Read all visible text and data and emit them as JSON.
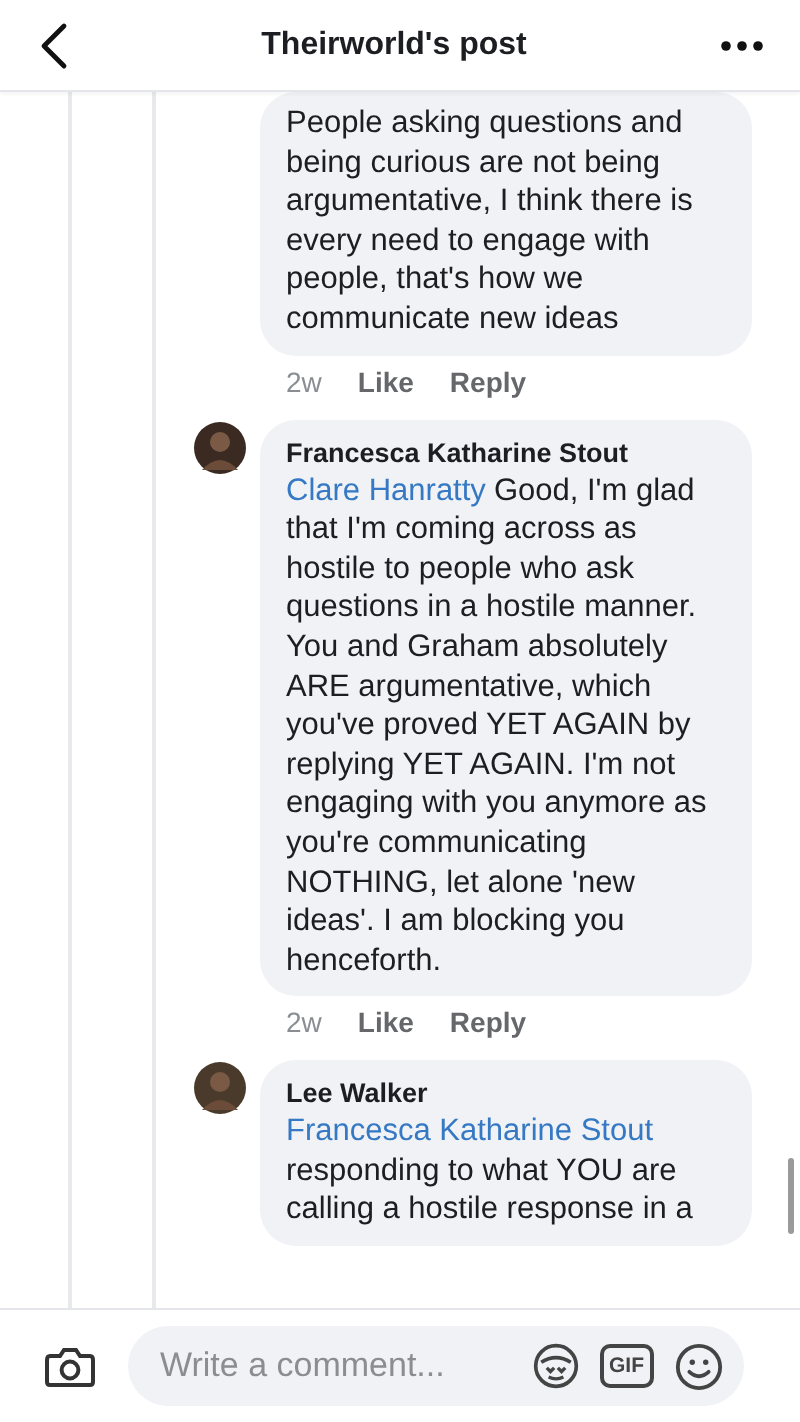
{
  "header": {
    "title": "Theirworld's post"
  },
  "comments": [
    {
      "text": "People asking questions and being curious are not being argumentative,  I think there is every need to engage with people,  that's how we communicate new ideas",
      "time": "2w",
      "actions": [
        "Like",
        "Reply"
      ]
    },
    {
      "author": "Francesca Katharine Stout",
      "mention": "Clare Hanratty",
      "text": "Good, I'm glad that I'm coming across as hostile to people who ask questions in a hostile manner. You and Graham absolutely ARE argumentative, which you've proved YET AGAIN by replying YET AGAIN. I'm not engaging with you anymore as you're communicating NOTHING, let alone 'new ideas'. I am blocking you henceforth.",
      "time": "2w",
      "actions": [
        "Like",
        "Reply"
      ]
    },
    {
      "author": "Lee Walker",
      "mention": "Francesca Katharine Stout",
      "text": "responding to what YOU are calling a hostile response in a"
    }
  ],
  "composer": {
    "placeholder": "Write a comment...",
    "gif_label": "GIF"
  }
}
